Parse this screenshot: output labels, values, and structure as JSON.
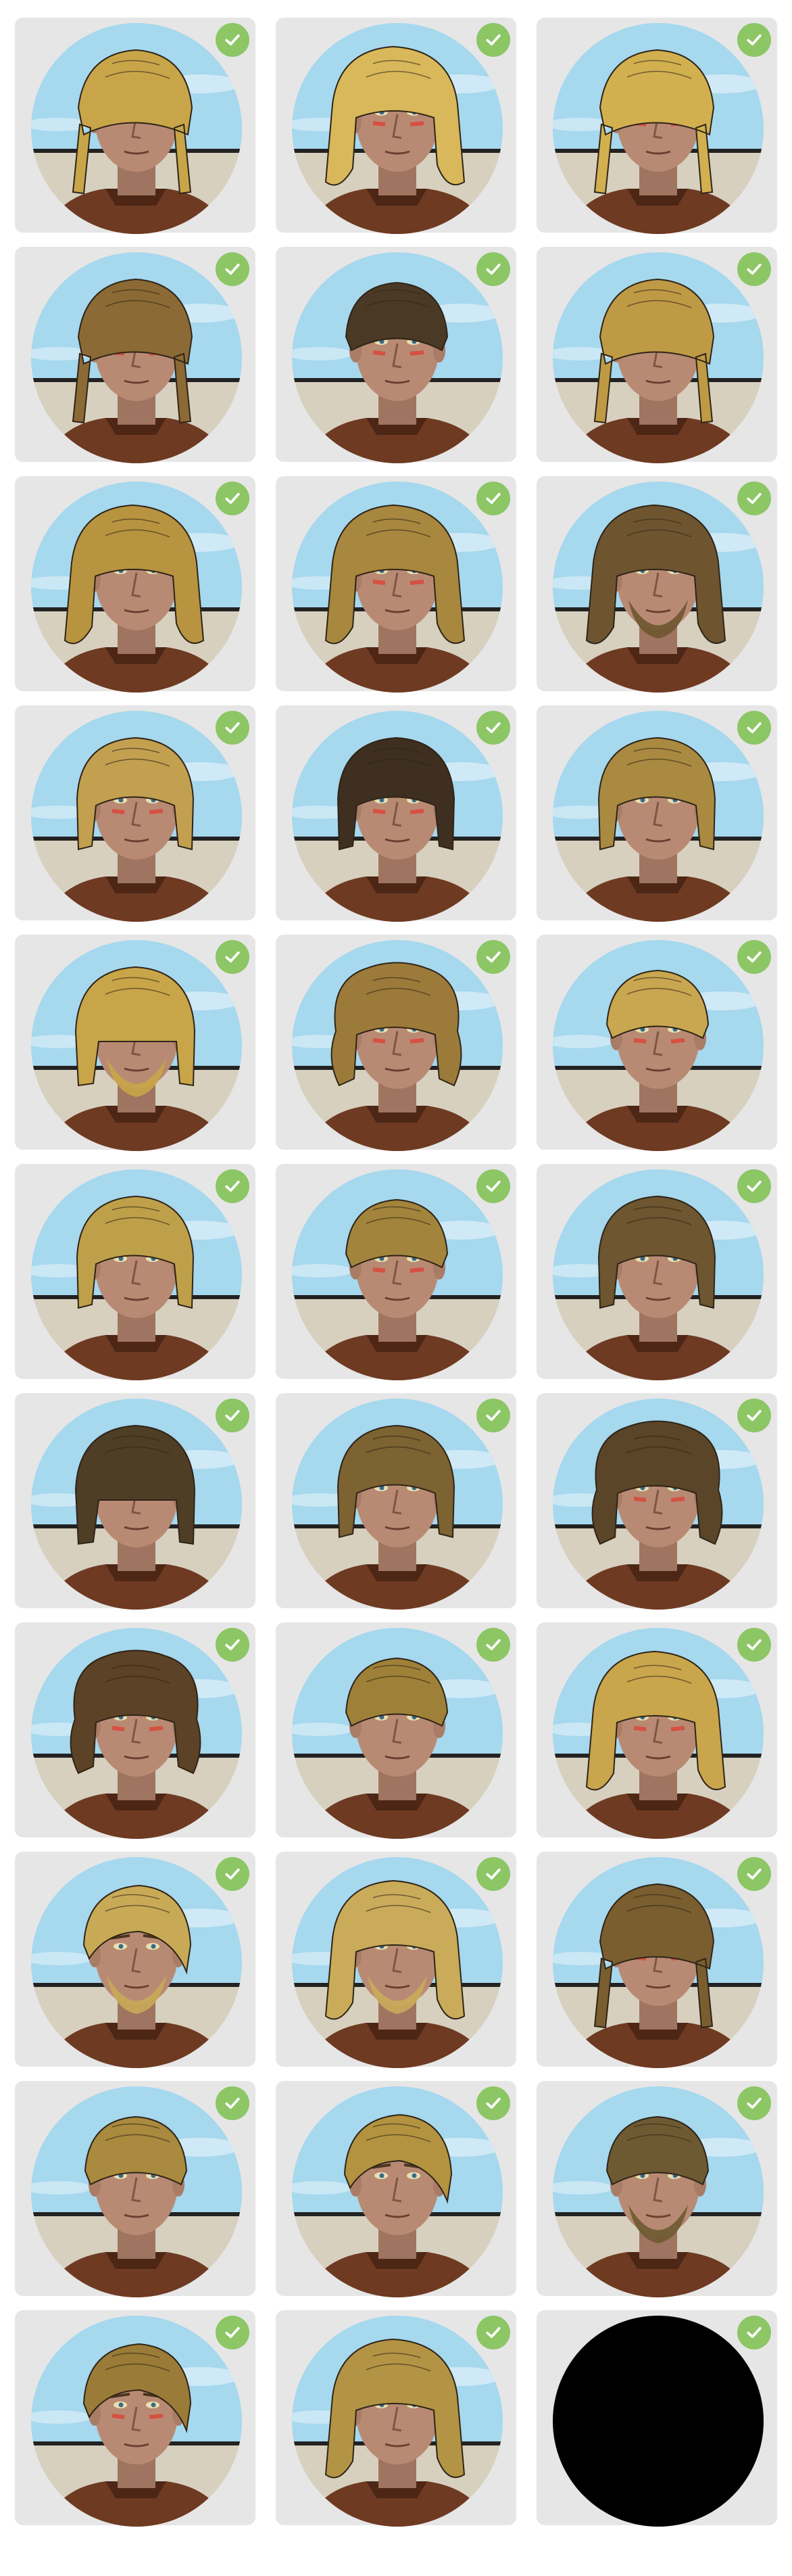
{
  "colors": {
    "card_bg": "#e6e6e6",
    "check_bg": "#8cc665",
    "check_mark": "#ffffff",
    "sky": "#a6d8ee",
    "wall": "#d7d0bf",
    "armor": "#6e3a22",
    "skin": "#b98a73",
    "empty_slot": "#000000"
  },
  "icons": {
    "check": "check-icon"
  },
  "portraits": [
    {
      "id": 1,
      "hair": "#c9a54a",
      "style": "braids",
      "paint": "none",
      "beard": false,
      "selected": true
    },
    {
      "id": 2,
      "hair": "#d8b85a",
      "style": "long",
      "paint": "red",
      "beard": false,
      "selected": true
    },
    {
      "id": 3,
      "hair": "#d2b050",
      "style": "braids",
      "paint": "red",
      "beard": false,
      "selected": true
    },
    {
      "id": 4,
      "hair": "#8c6a35",
      "style": "braids",
      "paint": "red",
      "beard": false,
      "selected": true
    },
    {
      "id": 5,
      "hair": "#4a3a25",
      "style": "short",
      "paint": "red",
      "beard": false,
      "selected": true
    },
    {
      "id": 6,
      "hair": "#bf9a45",
      "style": "braids",
      "paint": "none",
      "beard": false,
      "selected": true
    },
    {
      "id": 7,
      "hair": "#b89440",
      "style": "long",
      "paint": "none",
      "beard": false,
      "selected": true
    },
    {
      "id": 8,
      "hair": "#a8873e",
      "style": "long",
      "paint": "red",
      "beard": false,
      "selected": true
    },
    {
      "id": 9,
      "hair": "#6e5530",
      "style": "long",
      "paint": "none",
      "beard": true,
      "selected": true
    },
    {
      "id": 10,
      "hair": "#c2a050",
      "style": "medium",
      "paint": "red",
      "beard": false,
      "selected": true
    },
    {
      "id": 11,
      "hair": "#3e2f20",
      "style": "medium",
      "paint": "red",
      "beard": false,
      "selected": true
    },
    {
      "id": 12,
      "hair": "#a98a40",
      "style": "medium",
      "paint": "none",
      "beard": false,
      "selected": true
    },
    {
      "id": 13,
      "hair": "#c8a548",
      "style": "bob",
      "paint": "none",
      "beard": true,
      "selected": true
    },
    {
      "id": 14,
      "hair": "#9c7a3a",
      "style": "curly",
      "paint": "red",
      "beard": false,
      "selected": true
    },
    {
      "id": 15,
      "hair": "#c9a650",
      "style": "short",
      "paint": "red",
      "beard": false,
      "selected": true
    },
    {
      "id": 16,
      "hair": "#bfa04a",
      "style": "medium",
      "paint": "none",
      "beard": false,
      "selected": true
    },
    {
      "id": 17,
      "hair": "#a3843c",
      "style": "short",
      "paint": "red",
      "beard": false,
      "selected": true
    },
    {
      "id": 18,
      "hair": "#6d5630",
      "style": "medium",
      "paint": "none",
      "beard": false,
      "selected": true
    },
    {
      "id": 19,
      "hair": "#4f3e26",
      "style": "bob",
      "paint": "none",
      "beard": false,
      "selected": true
    },
    {
      "id": 20,
      "hair": "#7d6232",
      "style": "medium",
      "paint": "none",
      "beard": false,
      "selected": true
    },
    {
      "id": 21,
      "hair": "#5a4528",
      "style": "curly",
      "paint": "red",
      "beard": false,
      "selected": true
    },
    {
      "id": 22,
      "hair": "#5c4226",
      "style": "curly",
      "paint": "red",
      "beard": false,
      "selected": true
    },
    {
      "id": 23,
      "hair": "#9e8038",
      "style": "short",
      "paint": "none",
      "beard": false,
      "selected": true
    },
    {
      "id": 24,
      "hair": "#c9a54c",
      "style": "long",
      "paint": "red",
      "beard": false,
      "selected": true
    },
    {
      "id": 25,
      "hair": "#c8aa56",
      "style": "slick",
      "paint": "none",
      "beard": true,
      "selected": true
    },
    {
      "id": 26,
      "hair": "#c9ab5a",
      "style": "long",
      "paint": "none",
      "beard": true,
      "selected": true
    },
    {
      "id": 27,
      "hair": "#7a5e30",
      "style": "braids",
      "paint": "red",
      "beard": false,
      "selected": true
    },
    {
      "id": 28,
      "hair": "#a98a3e",
      "style": "short",
      "paint": "none",
      "beard": false,
      "selected": true
    },
    {
      "id": 29,
      "hair": "#b39340",
      "style": "slick",
      "paint": "none",
      "beard": false,
      "selected": true
    },
    {
      "id": 30,
      "hair": "#6e5a32",
      "style": "short",
      "paint": "none",
      "beard": true,
      "selected": true
    },
    {
      "id": 31,
      "hair": "#9a7c38",
      "style": "slick",
      "paint": "red",
      "beard": false,
      "selected": true
    },
    {
      "id": 32,
      "hair": "#b39444",
      "style": "long",
      "paint": "none",
      "beard": false,
      "selected": true
    },
    {
      "id": 33,
      "hair": "#000000",
      "style": "empty",
      "paint": "none",
      "beard": false,
      "selected": true
    }
  ]
}
